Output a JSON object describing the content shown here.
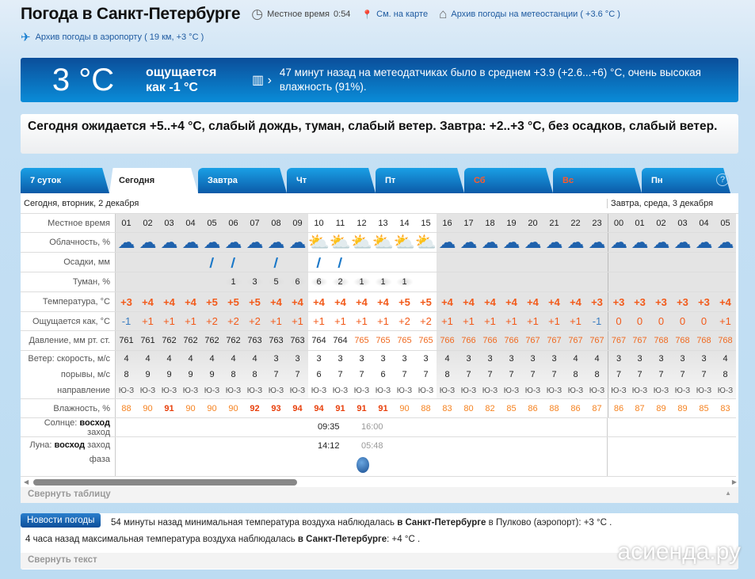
{
  "header": {
    "title": "Погода в Санкт-Петербурге",
    "local_time_label": "Местное время",
    "local_time": "0:54",
    "map_link": "См. на карте",
    "station_archive": "Архив погоды на метеостанции ( +3.6 °C )",
    "airport_archive": "Архив погоды в аэропорту ( 19 км, +3 °C )"
  },
  "now": {
    "temp": "3 °C",
    "feels_1": "ощущается",
    "feels_2": "как -1 °C",
    "message": "47 минут назад на метеодатчиках было в среднем +3.9 (+2.6...+6) °C, очень высокая влажность (91%)."
  },
  "summary": "Сегодня ожидается +5..+4 °C, слабый дождь, туман, слабый ветер. Завтра: +2..+3 °C, без осадков, слабый ветер.",
  "tabs": [
    {
      "label": "7 суток"
    },
    {
      "label": "Сегодня",
      "active": true
    },
    {
      "label": "Завтра"
    },
    {
      "label": "Чт"
    },
    {
      "label": "Пт"
    },
    {
      "label": "Сб",
      "weekend": true
    },
    {
      "label": "Вс",
      "weekend": true
    },
    {
      "label": "Пн"
    }
  ],
  "help_label": "?",
  "table": {
    "today_label": "Сегодня, вторник, 2 декабря",
    "tomorrow_label": "Завтра, среда, 3 декабря",
    "row_labels": {
      "time": "Местное время",
      "cloud": "Облачность, %",
      "precip": "Осадки, мм",
      "fog": "Туман, %",
      "temp": "Температура, °C",
      "feels": "Ощущается как, °C",
      "pressure": "Давление, мм рт. ст.",
      "wind_speed": "Ветер: скорость, м/с",
      "gusts": "порывы, м/с",
      "direction": "направление",
      "humidity": "Влажность, %",
      "sun_prefix": "Солнце:",
      "sun_rise": "восход",
      "sun_set": "заход",
      "moon_prefix": "Луна:",
      "moon_rise": "восход",
      "moon_set": "заход",
      "moon_phase": "фаза"
    },
    "hours": [
      "01",
      "02",
      "03",
      "04",
      "05",
      "06",
      "07",
      "08",
      "09",
      "10",
      "11",
      "12",
      "13",
      "14",
      "15",
      "16",
      "17",
      "18",
      "19",
      "20",
      "21",
      "22",
      "23",
      "00",
      "01",
      "02",
      "03",
      "04",
      "05"
    ],
    "cloud": [
      "partly",
      "over",
      "over",
      "over",
      "over",
      "partly",
      "over",
      "partly",
      "partly",
      "sun",
      "sun",
      "sun",
      "sun",
      "sun",
      "sun",
      "over",
      "over",
      "partly",
      "partly",
      "partly",
      "partly",
      "night",
      "partly",
      "night",
      "partly",
      "partly",
      "partly",
      "partly",
      "partly"
    ],
    "precip": [
      0,
      0,
      0,
      0,
      1,
      1,
      0,
      1,
      0,
      1,
      1,
      0,
      0,
      0,
      0,
      0,
      0,
      0,
      0,
      0,
      0,
      0,
      0,
      0,
      0,
      0,
      0,
      0,
      0
    ],
    "fog": [
      "",
      "",
      "",
      "",
      "",
      "1",
      "3",
      "5",
      "6",
      "6",
      "2",
      "1",
      "1",
      "1",
      "",
      "",
      "",
      "",
      "",
      "",
      "",
      "",
      "",
      "",
      "",
      "",
      "",
      "",
      ""
    ],
    "temp": [
      "+3",
      "+4",
      "+4",
      "+4",
      "+5",
      "+5",
      "+5",
      "+4",
      "+4",
      "+4",
      "+4",
      "+4",
      "+4",
      "+5",
      "+5",
      "+4",
      "+4",
      "+4",
      "+4",
      "+4",
      "+4",
      "+4",
      "+3",
      "+3",
      "+3",
      "+3",
      "+3",
      "+3",
      "+4"
    ],
    "feels": [
      "-1",
      "+1",
      "+1",
      "+1",
      "+2",
      "+2",
      "+2",
      "+1",
      "+1",
      "+1",
      "+1",
      "+1",
      "+1",
      "+2",
      "+2",
      "+1",
      "+1",
      "+1",
      "+1",
      "+1",
      "+1",
      "+1",
      "-1",
      "0",
      "0",
      "0",
      "0",
      "0",
      "+1"
    ],
    "pressure": [
      761,
      761,
      762,
      762,
      762,
      762,
      763,
      763,
      763,
      764,
      764,
      765,
      765,
      765,
      765,
      766,
      766,
      766,
      766,
      767,
      767,
      767,
      767,
      767,
      767,
      768,
      768,
      768,
      768
    ],
    "wind": [
      4,
      4,
      4,
      4,
      4,
      4,
      4,
      3,
      3,
      3,
      3,
      3,
      3,
      3,
      3,
      4,
      3,
      3,
      3,
      3,
      3,
      4,
      4,
      3,
      3,
      3,
      3,
      3,
      4
    ],
    "gusts": [
      8,
      9,
      9,
      9,
      9,
      8,
      8,
      7,
      7,
      6,
      7,
      7,
      6,
      7,
      7,
      8,
      7,
      7,
      7,
      7,
      7,
      8,
      8,
      7,
      7,
      7,
      7,
      7,
      8
    ],
    "direction": "Ю-З",
    "humidity": [
      88,
      90,
      91,
      90,
      90,
      90,
      92,
      93,
      94,
      94,
      91,
      91,
      91,
      90,
      88,
      83,
      80,
      82,
      85,
      86,
      88,
      86,
      87,
      86,
      87,
      89,
      89,
      85,
      83
    ],
    "sunrise": "09:35",
    "sunset": "16:00",
    "moonrise": "14:12",
    "moonset": "05:48"
  },
  "collapse_table": "Свернуть таблицу",
  "news": {
    "badge": "Новости погоды",
    "item1_a": "54 минуты назад минимальная температура воздуха наблюдалась ",
    "item1_b": "в Санкт-Петербурге",
    "item1_c": " в Пулково (аэропорт): +3 °C .",
    "item2_a": "4 часа назад максимальная температура воздуха наблюдалась ",
    "item2_b": "в Санкт-Петербурге",
    "item2_c": ": +4 °C .",
    "collapse": "Свернуть текст"
  },
  "watermark": "асиенда.ру"
}
